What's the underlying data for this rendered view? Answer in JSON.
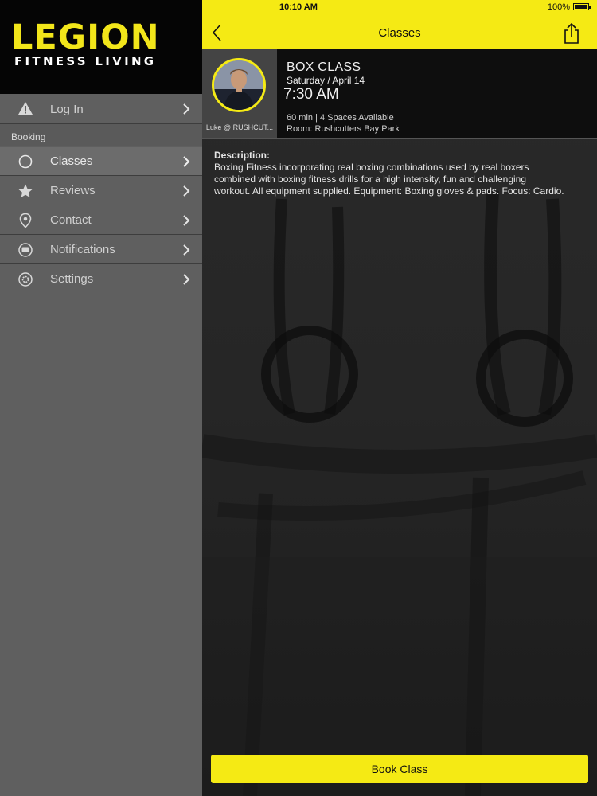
{
  "brand": {
    "name": "LEGION",
    "tagline": "FITNESS LIVING",
    "accent": "#f5ea14"
  },
  "status_bar": {
    "time": "10:10 AM",
    "battery": "100%"
  },
  "sidebar": {
    "items": [
      {
        "label": "Log In",
        "icon": "warning-icon"
      },
      {
        "label": "Classes",
        "icon": "circle-icon"
      },
      {
        "label": "Reviews",
        "icon": "star-icon"
      },
      {
        "label": "Contact",
        "icon": "location-pin-icon"
      },
      {
        "label": "Notifications",
        "icon": "chat-bubble-icon"
      },
      {
        "label": "Settings",
        "icon": "gear-icon"
      }
    ],
    "section_label": "Booking"
  },
  "nav": {
    "title": "Classes"
  },
  "class_info": {
    "trainer": "Luke @ RUSHCUT...",
    "title": "BOX CLASS",
    "date": "Saturday / April 14",
    "time": "7:30 AM",
    "meta": "60 min | 4 Spaces Available",
    "room": "Room: Rushcutters Bay Park"
  },
  "description": {
    "heading": "Description:",
    "text": "Boxing Fitness incorporating real boxing combinations used by real boxers combined with boxing fitness drills for a high intensity, fun and challenging workout. All equipment supplied. Equipment: Boxing gloves & pads.  Focus: Cardio."
  },
  "actions": {
    "book_label": "Book Class"
  }
}
